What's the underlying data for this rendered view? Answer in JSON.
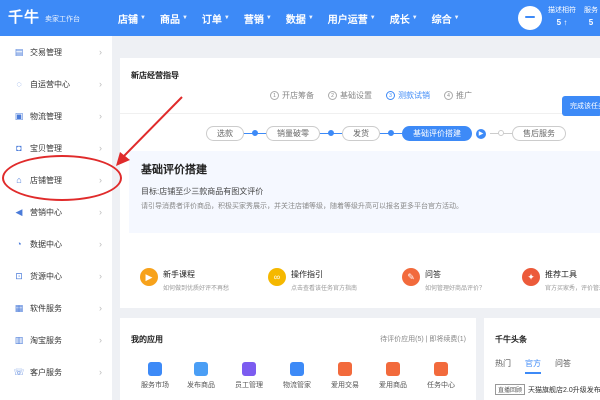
{
  "brand": {
    "logo": "千牛",
    "subtitle": "卖家工作台"
  },
  "nav": [
    {
      "label": "店铺"
    },
    {
      "label": "商品"
    },
    {
      "label": "订单"
    },
    {
      "label": "营销"
    },
    {
      "label": "数据"
    },
    {
      "label": "用户运营"
    },
    {
      "label": "成长"
    },
    {
      "label": "综合"
    }
  ],
  "top_stats": [
    {
      "label": "描述相符",
      "value": "5 ↑"
    },
    {
      "label": "服务",
      "value": "5"
    }
  ],
  "sidebar": {
    "items": [
      {
        "label": "交易管理",
        "icon": "transaction-icon"
      },
      {
        "label": "自运营中心",
        "icon": "chat-icon"
      },
      {
        "label": "物流管理",
        "icon": "logistics-icon"
      },
      {
        "label": "宝贝管理",
        "icon": "bag-icon"
      },
      {
        "label": "店铺管理",
        "icon": "shop-icon"
      },
      {
        "label": "营销中心",
        "icon": "megaphone-icon"
      },
      {
        "label": "数据中心",
        "icon": "data-icon"
      },
      {
        "label": "货源中心",
        "icon": "source-icon"
      },
      {
        "label": "软件服务",
        "icon": "software-icon"
      },
      {
        "label": "淘宝服务",
        "icon": "taobao-icon"
      },
      {
        "label": "客户服务",
        "icon": "service-icon"
      }
    ]
  },
  "guide": {
    "title": "新店经营指导",
    "steps": [
      {
        "label": "开店筹备",
        "num": "1"
      },
      {
        "label": "基础设置",
        "num": "2"
      },
      {
        "label": "测款试销",
        "num": "3"
      },
      {
        "label": "推广",
        "num": "4"
      }
    ],
    "stages": [
      {
        "label": "选款"
      },
      {
        "label": "销量破零"
      },
      {
        "label": "发货"
      },
      {
        "label": "基础评价搭建"
      },
      {
        "label": "售后服务"
      }
    ],
    "panel": {
      "title": "基础评价搭建",
      "goal": "目标:店铺至少三款商品有图文评价",
      "desc": "请引导消费者评价商品，积极买家秀展示，并关注店铺等级，随着等级升高可以报名更多平台官方活动。",
      "button": "完成该任务"
    },
    "tips": [
      {
        "title": "新手课程",
        "sub": "如何做到优质好评不再愁",
        "color": "#f7a21b"
      },
      {
        "title": "操作指引",
        "sub": "点击查看该任务官方指南",
        "color": "#f5b800"
      },
      {
        "title": "问答",
        "sub": "如何管理好商品评价？",
        "color": "#f26a3c"
      },
      {
        "title": "推荐工具",
        "sub": "官方买家秀，评价管理",
        "color": "#ec5a3a"
      }
    ]
  },
  "apps": {
    "title": "我的应用",
    "right": "待评价应用(5) | 即将续费(1)",
    "items": [
      {
        "label": "服务市场",
        "color": "#3d8af7"
      },
      {
        "label": "发布商品",
        "color": "#4a9ef5"
      },
      {
        "label": "员工管理",
        "color": "#7c5cf0"
      },
      {
        "label": "物流管家",
        "color": "#3d8af7"
      },
      {
        "label": "爱用交易",
        "color": "#f26a3c"
      },
      {
        "label": "爱用商品",
        "color": "#f26a3c"
      },
      {
        "label": "任务中心",
        "color": "#f26a3c"
      }
    ]
  },
  "news": {
    "title": "千牛头条",
    "tabs": [
      {
        "label": "热门"
      },
      {
        "label": "官方"
      },
      {
        "label": "问答"
      }
    ],
    "item": {
      "tag": "直播回顾",
      "text": "天猫旗舰店2.0升级发布"
    }
  }
}
